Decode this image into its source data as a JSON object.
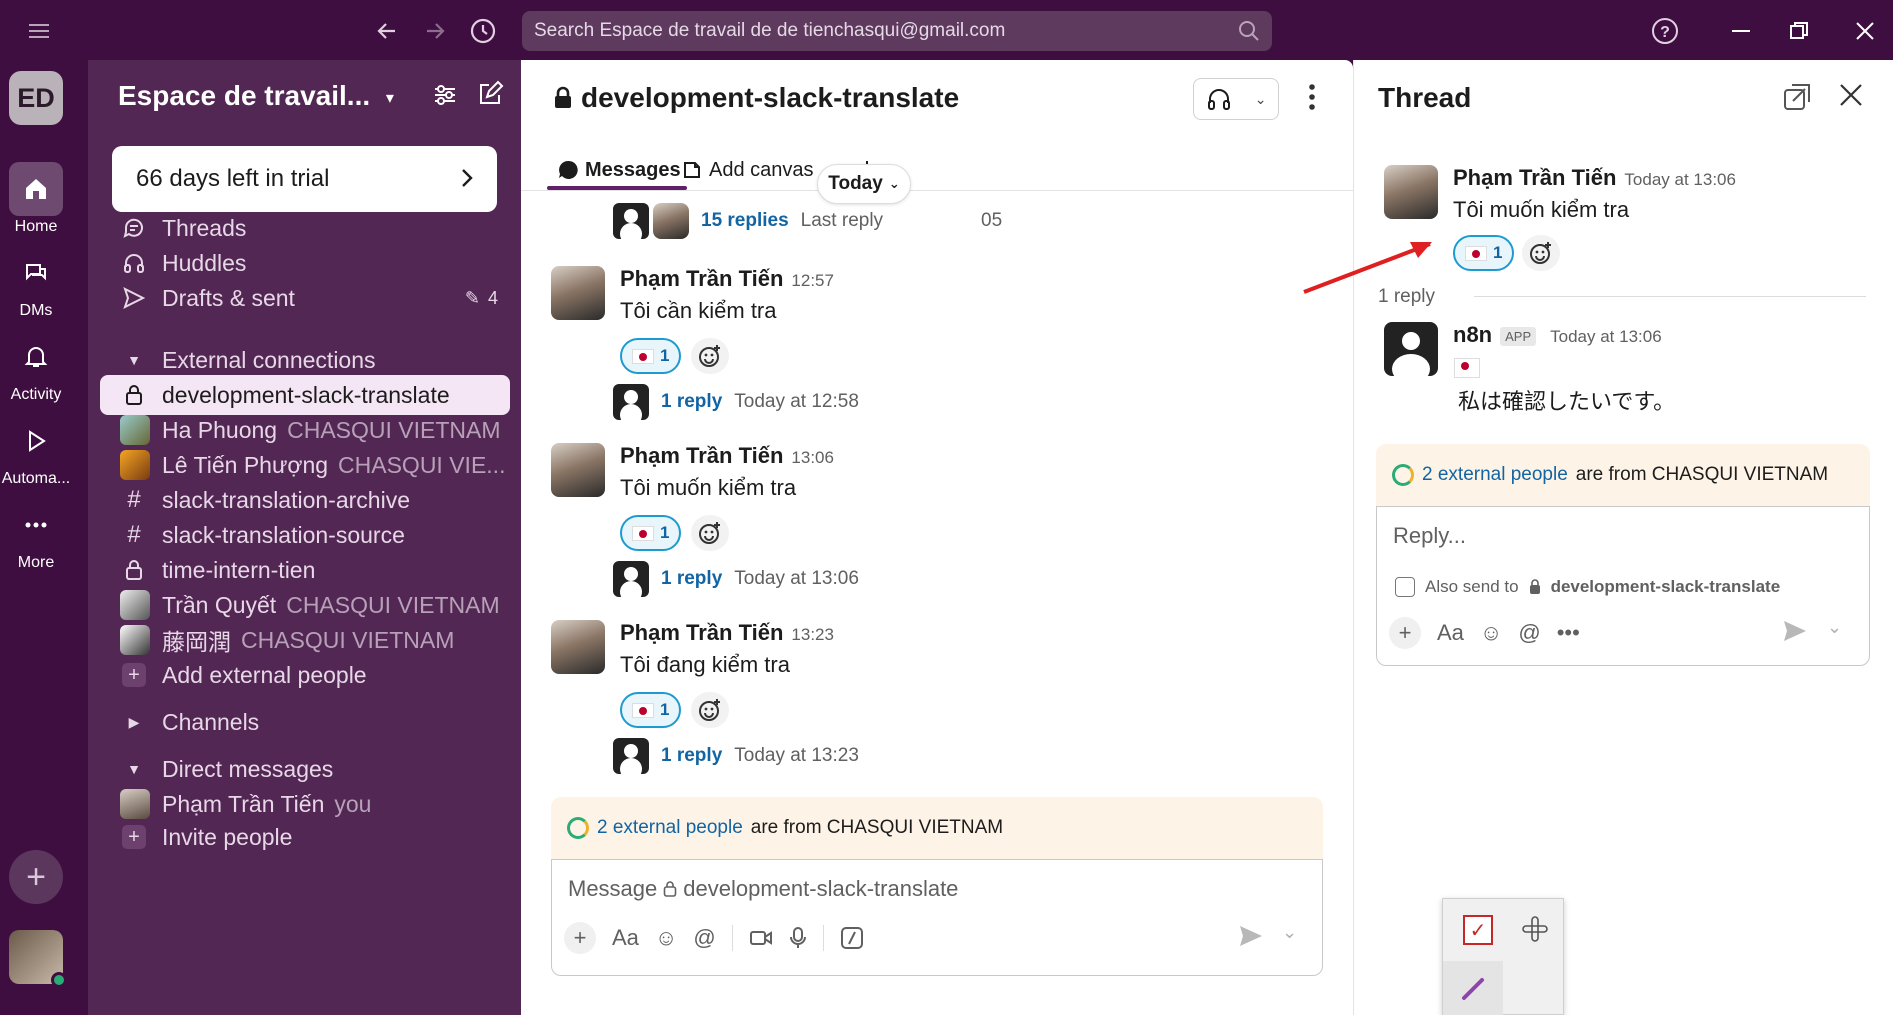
{
  "topbar": {
    "search_placeholder": "Search Espace de travail de de tienchasqui@gmail.com"
  },
  "rail": {
    "workspace_initials": "ED",
    "items": [
      {
        "label": "Home"
      },
      {
        "label": "DMs"
      },
      {
        "label": "Activity"
      },
      {
        "label": "Automa..."
      },
      {
        "label": "More"
      }
    ]
  },
  "sidebar": {
    "workspace_name": "Espace de travail...",
    "trial_text": "66 days left in trial",
    "nav": [
      {
        "label": "Threads"
      },
      {
        "label": "Huddles"
      },
      {
        "label": "Drafts & sent",
        "count": "4"
      }
    ],
    "external_header": "External connections",
    "external_items": [
      {
        "label": "development-slack-translate"
      },
      {
        "label": "Ha Phuong",
        "sub": "CHASQUI VIETNAM"
      },
      {
        "label": "Lê Tiến Phượng",
        "sub": "CHASQUI VIE..."
      },
      {
        "label": "slack-translation-archive"
      },
      {
        "label": "slack-translation-source"
      },
      {
        "label": "time-intern-tien"
      },
      {
        "label": "Trần Quyết",
        "sub": "CHASQUI VIETNAM"
      },
      {
        "label": "藤岡潤",
        "sub": "CHASQUI VIETNAM"
      },
      {
        "label": "Add external people"
      }
    ],
    "channels_header": "Channels",
    "dm_header": "Direct messages",
    "dm_items": [
      {
        "label": "Phạm Trần Tiến",
        "sub": "you"
      },
      {
        "label": "Invite people"
      }
    ]
  },
  "main": {
    "channel_title": "development-slack-translate",
    "tabs": {
      "messages": "Messages",
      "canvas": "Add canvas"
    },
    "top_thread": {
      "replies": "15 replies",
      "last_reply": "Last reply",
      "last_reply_suffix": "05"
    },
    "today_pill": "Today",
    "messages": [
      {
        "author": "Phạm Trần Tiến",
        "time": "12:57",
        "text": "Tôi cần kiểm tra",
        "reaction_count": "1",
        "replies": "1 reply",
        "reply_time": "Today at 12:58"
      },
      {
        "author": "Phạm Trần Tiến",
        "time": "13:06",
        "text": "Tôi muốn kiểm tra",
        "reaction_count": "1",
        "replies": "1 reply",
        "reply_time": "Today at 13:06"
      },
      {
        "author": "Phạm Trần Tiến",
        "time": "13:23",
        "text": "Tôi đang kiểm tra",
        "reaction_count": "1",
        "replies": "1 reply",
        "reply_time": "Today at 13:23"
      }
    ],
    "external_banner": {
      "link": "2 external people",
      "rest": "are from CHASQUI VIETNAM"
    },
    "composer_placeholder": "Message",
    "composer_channel": "development-slack-translate"
  },
  "thread": {
    "title": "Thread",
    "parent": {
      "author": "Phạm Trần Tiến",
      "time": "Today at 13:06",
      "text": "Tôi muốn kiểm tra",
      "reaction_count": "1"
    },
    "reply_count": "1 reply",
    "reply": {
      "author": "n8n",
      "badge": "APP",
      "time": "Today at 13:06",
      "text": "私は確認したいです。"
    },
    "external_banner": {
      "link": "2 external people",
      "rest": "are from CHASQUI VIETNAM"
    },
    "composer_placeholder": "Reply...",
    "also_send_label": "Also send to",
    "also_send_channel": "development-slack-translate"
  },
  "colors": {
    "aubergine": "#3f0e40",
    "sidebar": "#532753",
    "link": "#1264a3",
    "accent": "#1d9bd1"
  }
}
